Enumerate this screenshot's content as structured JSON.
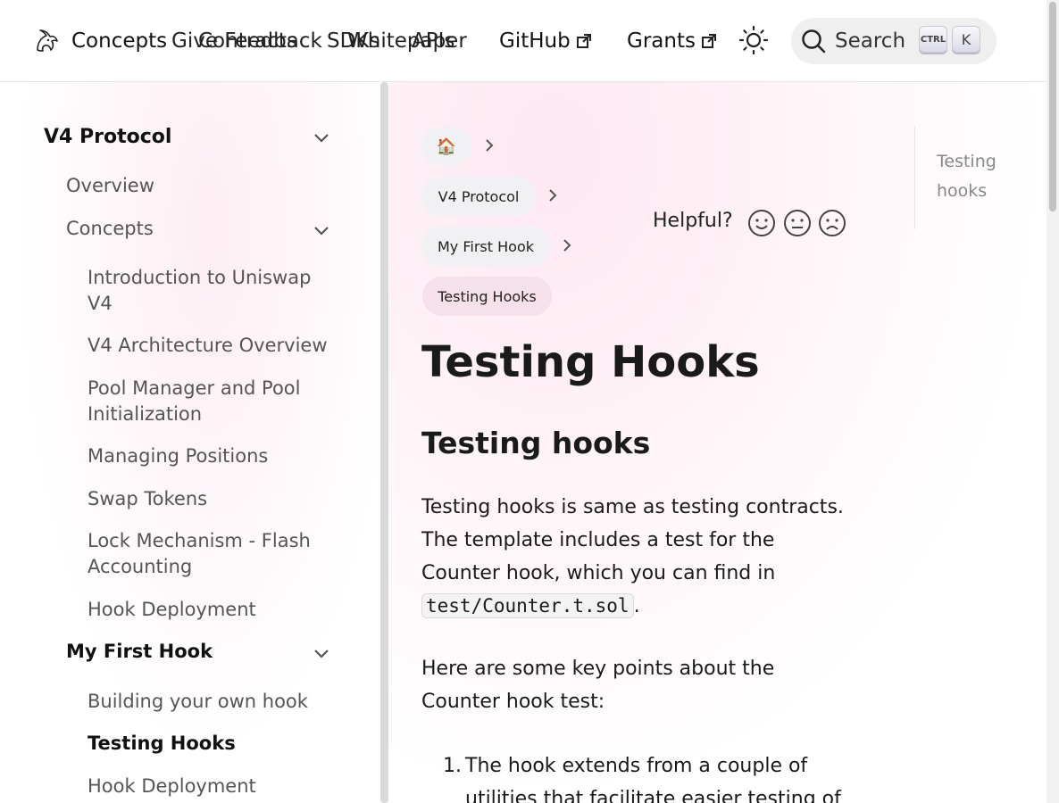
{
  "nav": {
    "links": [
      "Concepts",
      "Give Feedback",
      "Contracts",
      "SDKs",
      "Whitepaper",
      "APIs"
    ],
    "github": "GitHub",
    "grants": "Grants",
    "search_label": "Search",
    "kbd_ctrl": "CTRL",
    "kbd_k": "K"
  },
  "sidebar": {
    "section": "V4 Protocol",
    "overview": "Overview",
    "concepts": "Concepts",
    "concept_items": [
      "Introduction to Uniswap V4",
      "V4 Architecture Overview",
      "Pool Manager and Pool Initialization",
      "Managing Positions",
      "Swap Tokens",
      "Lock Mechanism - Flash Accounting",
      "Hook Deployment"
    ],
    "first_hook": "My First Hook",
    "first_hook_items": [
      "Building your own hook",
      "Testing Hooks",
      "Hook Deployment"
    ]
  },
  "breadcrumb": {
    "home_icon": "🏠",
    "items": [
      "V4 Protocol",
      "My First Hook",
      "Testing Hooks"
    ]
  },
  "feedback": {
    "label": "Helpful?"
  },
  "content": {
    "title": "Testing Hooks",
    "heading": "Testing hooks",
    "p1_text": "Testing hooks is same as testing contracts. The template includes a test for the Counter hook, which you can find in",
    "p1_code": "test/Counter.t.sol",
    "p1_end": ".",
    "p2": "Here are some key points about the Counter hook test:",
    "list_num": "1.",
    "list_item": "The hook extends from a couple of utilities that facilitate easier testing of"
  },
  "toc": {
    "title": "Testing hooks"
  },
  "colors": {
    "accent_pink": "#fde7f1",
    "crumb_current": "#f6e0ea"
  }
}
